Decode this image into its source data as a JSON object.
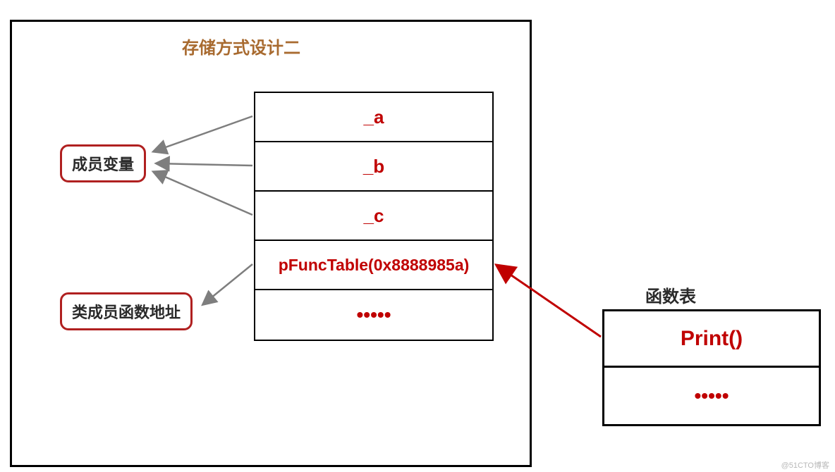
{
  "title": "存储方式设计二",
  "pills": {
    "member_var": "成员变量",
    "member_func_addr": "类成员函数地址"
  },
  "table_rows": {
    "r0": "_a",
    "r1": "_b",
    "r2": "_c",
    "r3": "pFuncTable(0x8888985a)",
    "r4": "•••••"
  },
  "func_table": {
    "title": "函数表",
    "r0": "Print()",
    "r1": "•••••"
  },
  "watermark": "@51CTO博客",
  "colors": {
    "accent_red": "#c00000",
    "border_red": "#b02020",
    "title_brown": "#a86a2f",
    "arrow_gray": "#7e7e7e"
  }
}
